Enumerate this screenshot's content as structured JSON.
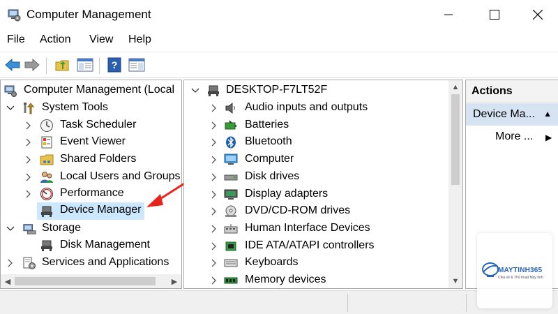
{
  "window": {
    "title": "Computer Management",
    "controls": {
      "minimize": "—",
      "maximize": "☐",
      "close": "✕"
    }
  },
  "menu": [
    "File",
    "Action",
    "View",
    "Help"
  ],
  "toolbar": {
    "icons": [
      "back-icon",
      "forward-icon",
      "up-folder-icon",
      "show-hide-console-tree-icon",
      "help-icon",
      "show-hide-action-pane-icon"
    ]
  },
  "tree": {
    "root": "Computer Management (Local",
    "system_tools": "System Tools",
    "task_scheduler": "Task Scheduler",
    "event_viewer": "Event Viewer",
    "shared_folders": "Shared Folders",
    "local_users": "Local Users and Groups",
    "performance": "Performance",
    "device_manager": "Device Manager",
    "storage": "Storage",
    "disk_management": "Disk Management",
    "services_apps": "Services and Applications"
  },
  "devices": {
    "computer_name": "DESKTOP-F7LT52F",
    "items": [
      "Audio inputs and outputs",
      "Batteries",
      "Bluetooth",
      "Computer",
      "Disk drives",
      "Display adapters",
      "DVD/CD-ROM drives",
      "Human Interface Devices",
      "IDE ATA/ATAPI controllers",
      "Keyboards",
      "Memory devices"
    ]
  },
  "actions": {
    "header": "Actions",
    "device_manager": "Device Ma...",
    "more": "More ..."
  },
  "watermark": {
    "brand": "MAYTINH365",
    "tagline": "Chia sẻ & Thủ thuật Máy tính"
  },
  "colors": {
    "selection": "#cce8ff",
    "actions_selected": "#d6e3f3",
    "arrow_annotation": "#e8231b",
    "brand_blue": "#2467b8"
  }
}
